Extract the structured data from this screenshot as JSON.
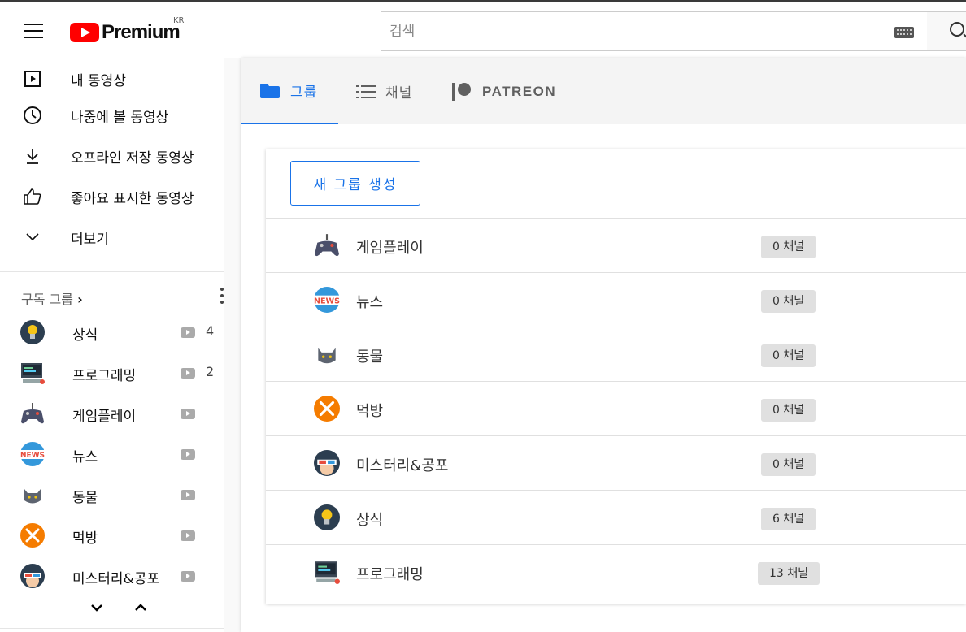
{
  "app": {
    "logo_text": "Premium",
    "region": "KR"
  },
  "search": {
    "placeholder": "검색"
  },
  "nav": [
    {
      "label": "내 동영상",
      "icon": "play-square-icon"
    },
    {
      "label": "나중에 볼 동영상",
      "icon": "clock-icon"
    },
    {
      "label": "오프라인 저장 동영상",
      "icon": "download-icon"
    },
    {
      "label": "좋아요 표시한 동영상",
      "icon": "thumbs-up-icon"
    },
    {
      "label": "더보기",
      "icon": "chevron-down-icon"
    }
  ],
  "subscriptions": {
    "header": "구독 그룹",
    "items": [
      {
        "label": "상식",
        "icon": "lightbulb-icon",
        "count": "4"
      },
      {
        "label": "프로그래밍",
        "icon": "computer-icon",
        "count": "2"
      },
      {
        "label": "게임플레이",
        "icon": "gamepad-icon",
        "count": ""
      },
      {
        "label": "뉴스",
        "icon": "news-icon",
        "count": ""
      },
      {
        "label": "동물",
        "icon": "cat-icon",
        "count": ""
      },
      {
        "label": "먹방",
        "icon": "utensils-icon",
        "count": ""
      },
      {
        "label": "미스터리&공포",
        "icon": "3d-glasses-icon",
        "count": ""
      }
    ]
  },
  "tabs": [
    {
      "label": "그룹",
      "icon": "folder-icon",
      "active": true
    },
    {
      "label": "채널",
      "icon": "list-icon",
      "active": false
    },
    {
      "label": "PATREON",
      "icon": "patreon-icon",
      "active": false
    }
  ],
  "groups": {
    "new_button": "새 그룹 생성",
    "rows": [
      {
        "label": "게임플레이",
        "icon": "gamepad-icon",
        "badge": "0 채널"
      },
      {
        "label": "뉴스",
        "icon": "news-icon",
        "badge": "0 채널"
      },
      {
        "label": "동물",
        "icon": "cat-icon",
        "badge": "0 채널"
      },
      {
        "label": "먹방",
        "icon": "utensils-icon",
        "badge": "0 채널"
      },
      {
        "label": "미스터리&공포",
        "icon": "3d-glasses-icon",
        "badge": "0 채널"
      },
      {
        "label": "상식",
        "icon": "lightbulb-icon",
        "badge": "6 채널"
      },
      {
        "label": "프로그래밍",
        "icon": "computer-icon",
        "badge": "13 채널"
      }
    ]
  },
  "colors": {
    "accent": "#1a73e8",
    "brand": "#ff0000"
  }
}
